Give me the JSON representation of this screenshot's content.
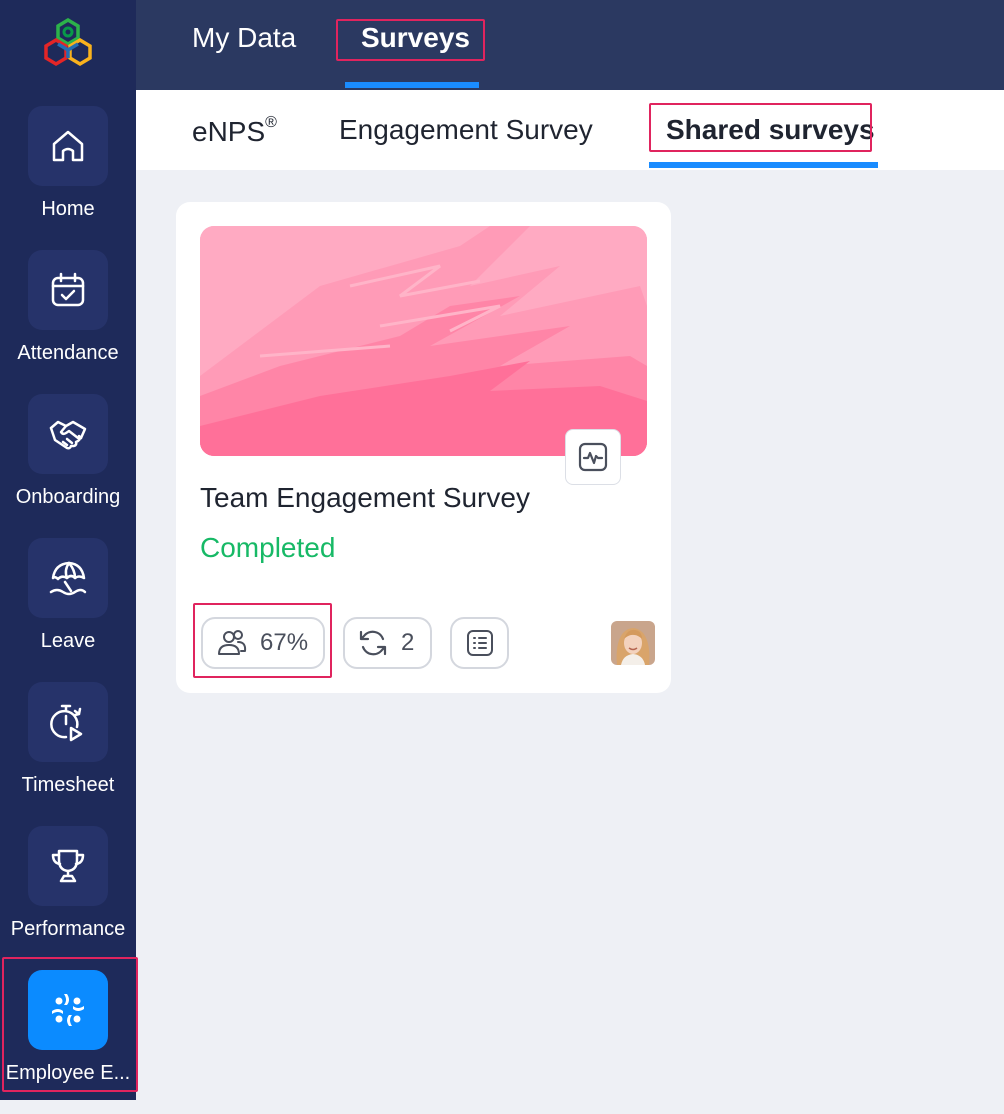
{
  "sidebar": {
    "items": [
      {
        "label": "Home",
        "icon": "home-icon"
      },
      {
        "label": "Attendance",
        "icon": "calendar-check-icon"
      },
      {
        "label": "Onboarding",
        "icon": "handshake-icon"
      },
      {
        "label": "Leave",
        "icon": "beach-umbrella-icon"
      },
      {
        "label": "Timesheet",
        "icon": "stopwatch-play-icon"
      },
      {
        "label": "Performance",
        "icon": "trophy-icon"
      },
      {
        "label": "Employee E...",
        "icon": "engagement-icon"
      }
    ],
    "active_color": "#0b8bff",
    "background": "#1e2a5a"
  },
  "top_tabs": {
    "my_data": "My Data",
    "surveys": "Surveys"
  },
  "sub_tabs": {
    "enps": "eNPS",
    "enps_mark": "®",
    "engagement": "Engagement Survey",
    "shared": "Shared surveys"
  },
  "survey_card": {
    "title": "Team Engagement Survey",
    "status": "Completed",
    "status_color": "#17b966",
    "participation": "67%",
    "cycles": "2",
    "banner_color": "#ffa9c0"
  },
  "highlight_color": "#e0245e"
}
